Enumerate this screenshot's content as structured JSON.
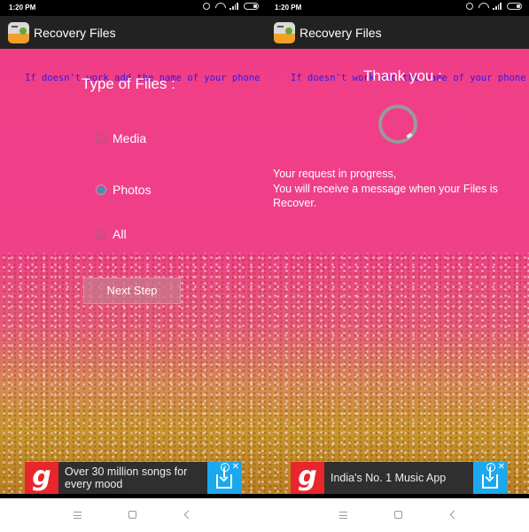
{
  "status_bar": {
    "time": "1:20 PM",
    "icons": [
      "alarm-icon",
      "wifi-icon",
      "signal-icon",
      "battery-icon"
    ]
  },
  "app": {
    "title": "Recovery Files",
    "icon": "recovery-app-icon"
  },
  "warning_text": "If doesn't work add the name of your phone",
  "screen_select": {
    "heading": "Type of Files :",
    "options": [
      {
        "label": "Media",
        "checked": false
      },
      {
        "label": "Photos",
        "checked": true
      },
      {
        "label": "All",
        "checked": false
      }
    ],
    "next_button": "Next Step",
    "ad": {
      "logo": "g",
      "text": "Over 30 million songs for every mood",
      "info": "i",
      "close": "✕"
    }
  },
  "screen_progress": {
    "heading": "Thank you :",
    "message_line1": "Your request in progress,",
    "message_line2": "You will receive a message when your Files is Recover.",
    "ad": {
      "logo": "g",
      "text": "India's No. 1 Music App",
      "info": "i",
      "close": "✕"
    }
  },
  "nav_bar": {
    "icons": [
      "menu-icon",
      "home-icon",
      "back-icon"
    ]
  },
  "colors": {
    "accent_radio": "#1aa4c4",
    "warning_text": "#2a1bf0",
    "app_bar": "#222222",
    "ad_logo_red": "#e8262c",
    "ad_cta_blue": "#1aa9ee"
  }
}
